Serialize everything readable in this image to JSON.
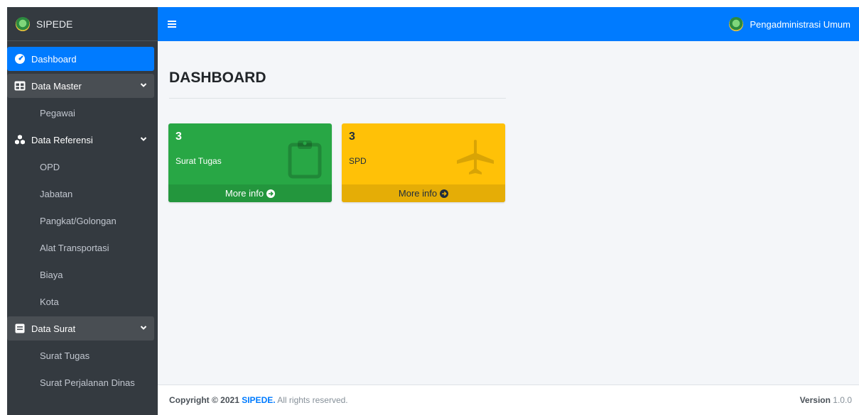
{
  "brand": {
    "title": "SIPEDE"
  },
  "topbar": {
    "user_name": "Pengadministrasi Umum"
  },
  "sidebar": {
    "dashboard": "Dashboard",
    "data_master": "Data Master",
    "pegawai": "Pegawai",
    "data_referensi": "Data Referensi",
    "opd": "OPD",
    "jabatan": "Jabatan",
    "pangkat": "Pangkat/Golongan",
    "alat_transportasi": "Alat Transportasi",
    "biaya": "Biaya",
    "kota": "Kota",
    "data_surat": "Data Surat",
    "surat_tugas": "Surat Tugas",
    "surat_perjalanan_dinas": "Surat Perjalanan Dinas"
  },
  "main": {
    "title": "DASHBOARD",
    "boxes": [
      {
        "count": "3",
        "label": "Surat Tugas",
        "more": "More info",
        "icon": "clipboard-icon",
        "color": "#28a745"
      },
      {
        "count": "3",
        "label": "SPD",
        "more": "More info",
        "icon": "plane-icon",
        "color": "#ffc107"
      }
    ]
  },
  "footer": {
    "copyright": "Copyright © 2021",
    "brand_link": "SIPEDE.",
    "rights": "All rights reserved.",
    "version_label": "Version",
    "version": "1.0.0"
  }
}
